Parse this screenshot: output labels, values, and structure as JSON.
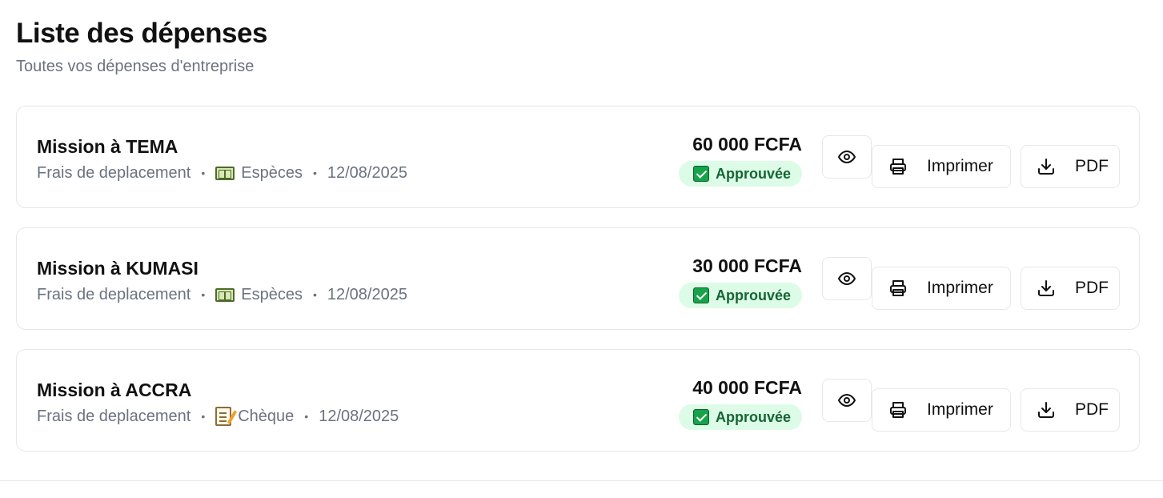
{
  "header": {
    "title": "Liste des dépenses",
    "subtitle": "Toutes vos dépenses d'entreprise"
  },
  "separator": "•",
  "colors": {
    "approved_bg": "#dcfce7",
    "approved_text": "#166534",
    "border": "#e5e7eb",
    "muted_text": "#6b7280"
  },
  "expenses": [
    {
      "title": "Mission à TEMA",
      "category": "Frais de deplacement",
      "payment_icon": "cash-icon",
      "payment_method": "Espèces",
      "date": "12/08/2025",
      "amount": "60 000 FCFA",
      "status": "Approuvée",
      "actions": {
        "print": "Imprimer",
        "pdf": "PDF"
      }
    },
    {
      "title": "Mission à KUMASI",
      "category": "Frais de deplacement",
      "payment_icon": "cash-icon",
      "payment_method": "Espèces",
      "date": "12/08/2025",
      "amount": "30 000 FCFA",
      "status": "Approuvée",
      "actions": {
        "print": "Imprimer",
        "pdf": "PDF"
      }
    },
    {
      "title": "Mission à ACCRA",
      "category": "Frais de deplacement",
      "payment_icon": "memo-icon",
      "payment_method": "Chèque",
      "date": "12/08/2025",
      "amount": "40 000 FCFA",
      "status": "Approuvée",
      "actions": {
        "print": "Imprimer",
        "pdf": "PDF"
      }
    }
  ]
}
